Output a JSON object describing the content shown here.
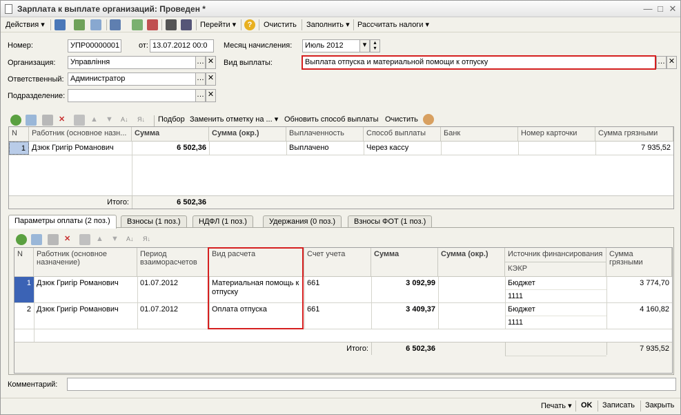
{
  "window": {
    "title": "Зарплата к выплате организаций: Проведен *"
  },
  "toolbar": {
    "actions": "Действия",
    "goto": "Перейти",
    "clear": "Очистить",
    "fill": "Заполнить",
    "calc_taxes": "Рассчитать налоги"
  },
  "form": {
    "number_label": "Номер:",
    "number_value": "УПР00000001",
    "from_label": "от:",
    "from_value": "13.07.2012 00:0",
    "month_label": "Месяц начисления:",
    "month_value": "Июль 2012",
    "org_label": "Организация:",
    "org_value": "Управлiння",
    "pay_type_label": "Вид выплаты:",
    "pay_type_value": "Выплата отпуска и материальной помощи к отпуску",
    "responsible_label": "Ответственный:",
    "responsible_value": "Администратор",
    "division_label": "Подразделение:",
    "division_value": ""
  },
  "grid_toolbar": {
    "select": "Подбор",
    "replace_mark": "Заменить отметку на ...",
    "update_method": "Обновить способ выплаты",
    "clear": "Очистить"
  },
  "top_grid": {
    "headers": [
      "N",
      "Работник (основное назн...",
      "Сумма",
      "Сумма (окр.)",
      "Выплаченность",
      "Способ выплаты",
      "Банк",
      "Номер карточки",
      "Сумма грязными"
    ],
    "rows": [
      [
        "1",
        "Дзюк Григiр Романович",
        "6 502,36",
        "",
        "Выплачено",
        "Через кассу",
        "",
        "",
        "7 935,52"
      ]
    ],
    "total_label": "Итого:",
    "total_sum": "6 502,36"
  },
  "tabs": [
    "Параметры оплаты (2 поз.)",
    "Взносы (1 поз.)",
    "НДФЛ (1 поз.)",
    "Удержания (0 поз.)",
    "Взносы ФОТ (1 поз.)"
  ],
  "bottom_grid": {
    "headers": {
      "n": "N",
      "worker": "Работник (основное назначение)",
      "period": "Период взаиморасчетов",
      "calc_type": "Вид расчета",
      "account": "Счет учета",
      "sum": "Сумма",
      "sum_round": "Сумма (окр.)",
      "source": "Источник финансирования",
      "kekr": "КЭКР",
      "gross": "Сумма грязными"
    },
    "rows": [
      {
        "n": "1",
        "worker": "Дзюк Григiр Романович",
        "period": "01.07.2012",
        "calc_type": "Материальная помощь к отпуску",
        "account": "661",
        "sum": "3 092,99",
        "source": "Бюджет",
        "kekr": "1111",
        "gross": "3 774,70"
      },
      {
        "n": "2",
        "worker": "Дзюк Григiр Романович",
        "period": "01.07.2012",
        "calc_type": "Оплата отпуска",
        "account": "661",
        "sum": "3 409,37",
        "source": "Бюджет",
        "kekr": "1111",
        "gross": "4 160,82"
      }
    ],
    "total_label": "Итого:",
    "total_sum": "6 502,36",
    "total_gross": "7 935,52"
  },
  "comment_label": "Комментарий:",
  "bottom_bar": {
    "print": "Печать",
    "ok": "OK",
    "save": "Записать",
    "close": "Закрыть"
  }
}
